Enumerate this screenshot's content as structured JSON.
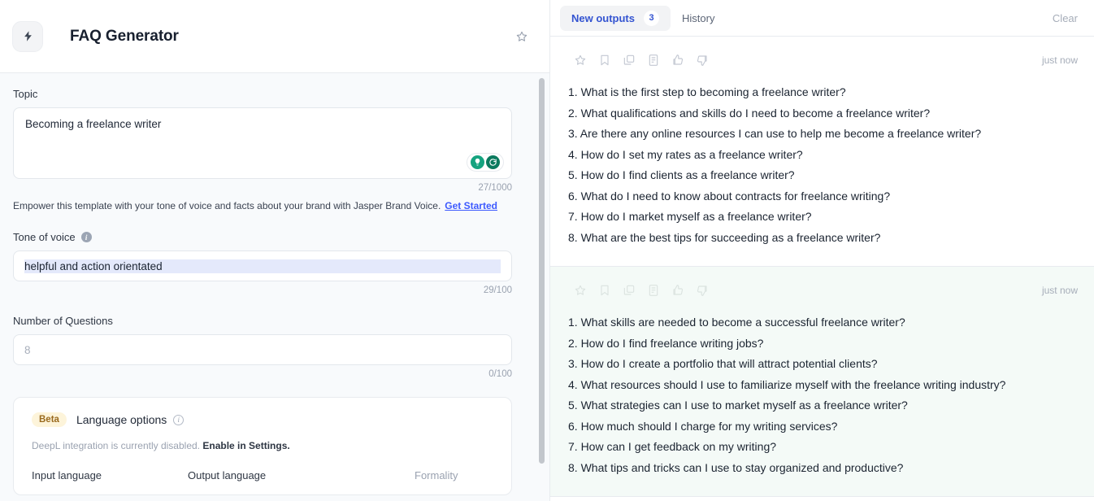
{
  "left": {
    "bolt_icon": "lightning-bolt-icon",
    "title": "FAQ Generator",
    "favorite_icon": "star-icon",
    "topic": {
      "label": "Topic",
      "value": "Becoming a freelance writer",
      "counter": "27/1000",
      "assist_icons": [
        "lightbulb-icon",
        "grammarly-refresh-icon"
      ]
    },
    "brand_note": {
      "text": "Empower this template with your tone of voice and facts about your brand with Jasper Brand Voice.",
      "link": "Get Started"
    },
    "tone": {
      "label": "Tone of voice",
      "info_icon": "info-icon",
      "value": "helpful and action orientated",
      "counter": "29/100"
    },
    "questions": {
      "label": "Number of Questions",
      "placeholder": "8",
      "value": "",
      "counter": "0/100"
    },
    "language_options": {
      "badge": "Beta",
      "title": "Language options",
      "info_icon": "info-icon",
      "disabled_note": "DeepL integration is currently disabled.",
      "enable_link": "Enable in Settings.",
      "columns": [
        "Input language",
        "Output language",
        "Formality"
      ]
    }
  },
  "right": {
    "tabs": [
      {
        "label": "New outputs",
        "badge": "3",
        "active": true
      },
      {
        "label": "History",
        "badge": "",
        "active": false
      }
    ],
    "clear_label": "Clear",
    "toolbar_icons": [
      "star-icon",
      "bookmark-icon",
      "copy-icon",
      "document-icon",
      "thumbs-up-icon",
      "thumbs-down-icon"
    ],
    "outputs": [
      {
        "timestamp": "just now",
        "items": [
          "1. What is the first step to becoming a freelance writer?",
          "2. What qualifications and skills do I need to become a freelance writer?",
          "3. Are there any online resources I can use to help me become a freelance writer?",
          "4. How do I set my rates as a freelance writer?",
          "5. How do I find clients as a freelance writer?",
          "6. What do I need to know about contracts for freelance writing?",
          "7. How do I market myself as a freelance writer?",
          "8. What are the best tips for succeeding as a freelance writer?"
        ]
      },
      {
        "timestamp": "just now",
        "items": [
          "1. What skills are needed to become a successful freelance writer?",
          "2. How do I find freelance writing jobs?",
          "3. How do I create a portfolio that will attract potential clients?",
          "4. What resources should I use to familiarize myself with the freelance writing industry?",
          "5. What strategies can I use to market myself as a freelance writer?",
          "6. How much should I charge for my writing services?",
          "7. How can I get feedback on my writing?",
          "8. What tips and tricks can I use to stay organized and productive?"
        ]
      }
    ]
  },
  "colors": {
    "accent_blue": "#3454d1",
    "link_blue": "#3d5afe",
    "grammarly_green": "#15a37f",
    "beta_bg": "#fdf4da",
    "beta_text": "#9a6a1e",
    "tinted_card": "#f4faf7",
    "panel_bg": "#f8fafc"
  }
}
